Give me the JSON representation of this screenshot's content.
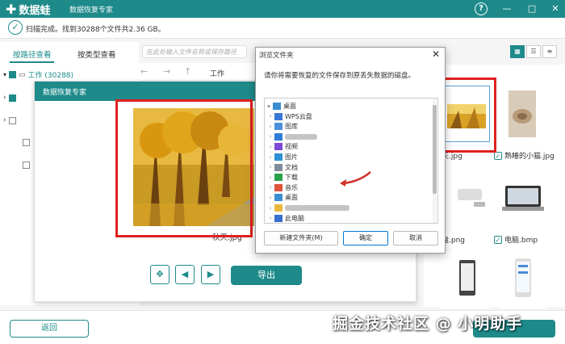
{
  "app": {
    "name": "数据蛙",
    "subtitle": "数据恢复专家"
  },
  "window_controls": {
    "help": "?",
    "minimize": "—",
    "maximize": "□",
    "close": "✕"
  },
  "status": {
    "text": "扫描完成。找到30288个文件共2.36 GB。"
  },
  "tabs": [
    {
      "label": "按路径查看"
    },
    {
      "label": "按类型查看"
    }
  ],
  "tree": [
    {
      "label": "工作 (30288)"
    }
  ],
  "search": {
    "placeholder": "在此处输入文件名称或保存路径"
  },
  "nav": {
    "back": "←",
    "forward": "→",
    "up": "↑",
    "folder": "工作"
  },
  "preview": {
    "title": "数据恢复专家",
    "filename": "秋天.jpg",
    "export_label": "导出",
    "fit": "✥",
    "prev": "◀",
    "next": "▶"
  },
  "dialog": {
    "title": "浏览文件夹",
    "close": "✕",
    "description": "请你将需要恢复的文件保存到原丢失数据的磁盘。",
    "items": [
      {
        "label": "桌面",
        "icon_color": "#3b8ed0"
      },
      {
        "label": "WPS云盘",
        "icon_color": "#3a78d8"
      },
      {
        "label": "图库",
        "icon_color": "#4a90d9"
      },
      {
        "label": "",
        "icon_color": "#2f7bd6"
      },
      {
        "label": "视频",
        "icon_color": "#7b4bd6"
      },
      {
        "label": "图片",
        "icon_color": "#2c8fd6"
      },
      {
        "label": "文档",
        "icon_color": "#7f8c9a"
      },
      {
        "label": "下载",
        "icon_color": "#2aa04a"
      },
      {
        "label": "音乐",
        "icon_color": "#e0533a"
      },
      {
        "label": "桌面",
        "icon_color": "#3b8ed0"
      },
      {
        "label": "",
        "icon_color": "#e8b93a"
      },
      {
        "label": "此电脑",
        "icon_color": "#3a6fd0"
      }
    ],
    "new_folder": "新建文件夹(M)",
    "ok": "确定",
    "cancel": "取消"
  },
  "thumbs": [
    {
      "label": "秋天.jpg",
      "display": "天.jpg"
    },
    {
      "label": "熟睡的小猫.jpg"
    },
    {
      "label": "U盘.png",
      "display": "盘.png"
    },
    {
      "label": "电脑.bmp"
    }
  ],
  "view_icons": [
    "grid-view-icon",
    "list-view-icon",
    "detail-view-icon"
  ],
  "bottom": {
    "back_label": "返回"
  },
  "watermark": "掘金技术社区 @ 小明助手",
  "colors": {
    "accent": "#1f8a8a",
    "highlight": "#e02020"
  }
}
